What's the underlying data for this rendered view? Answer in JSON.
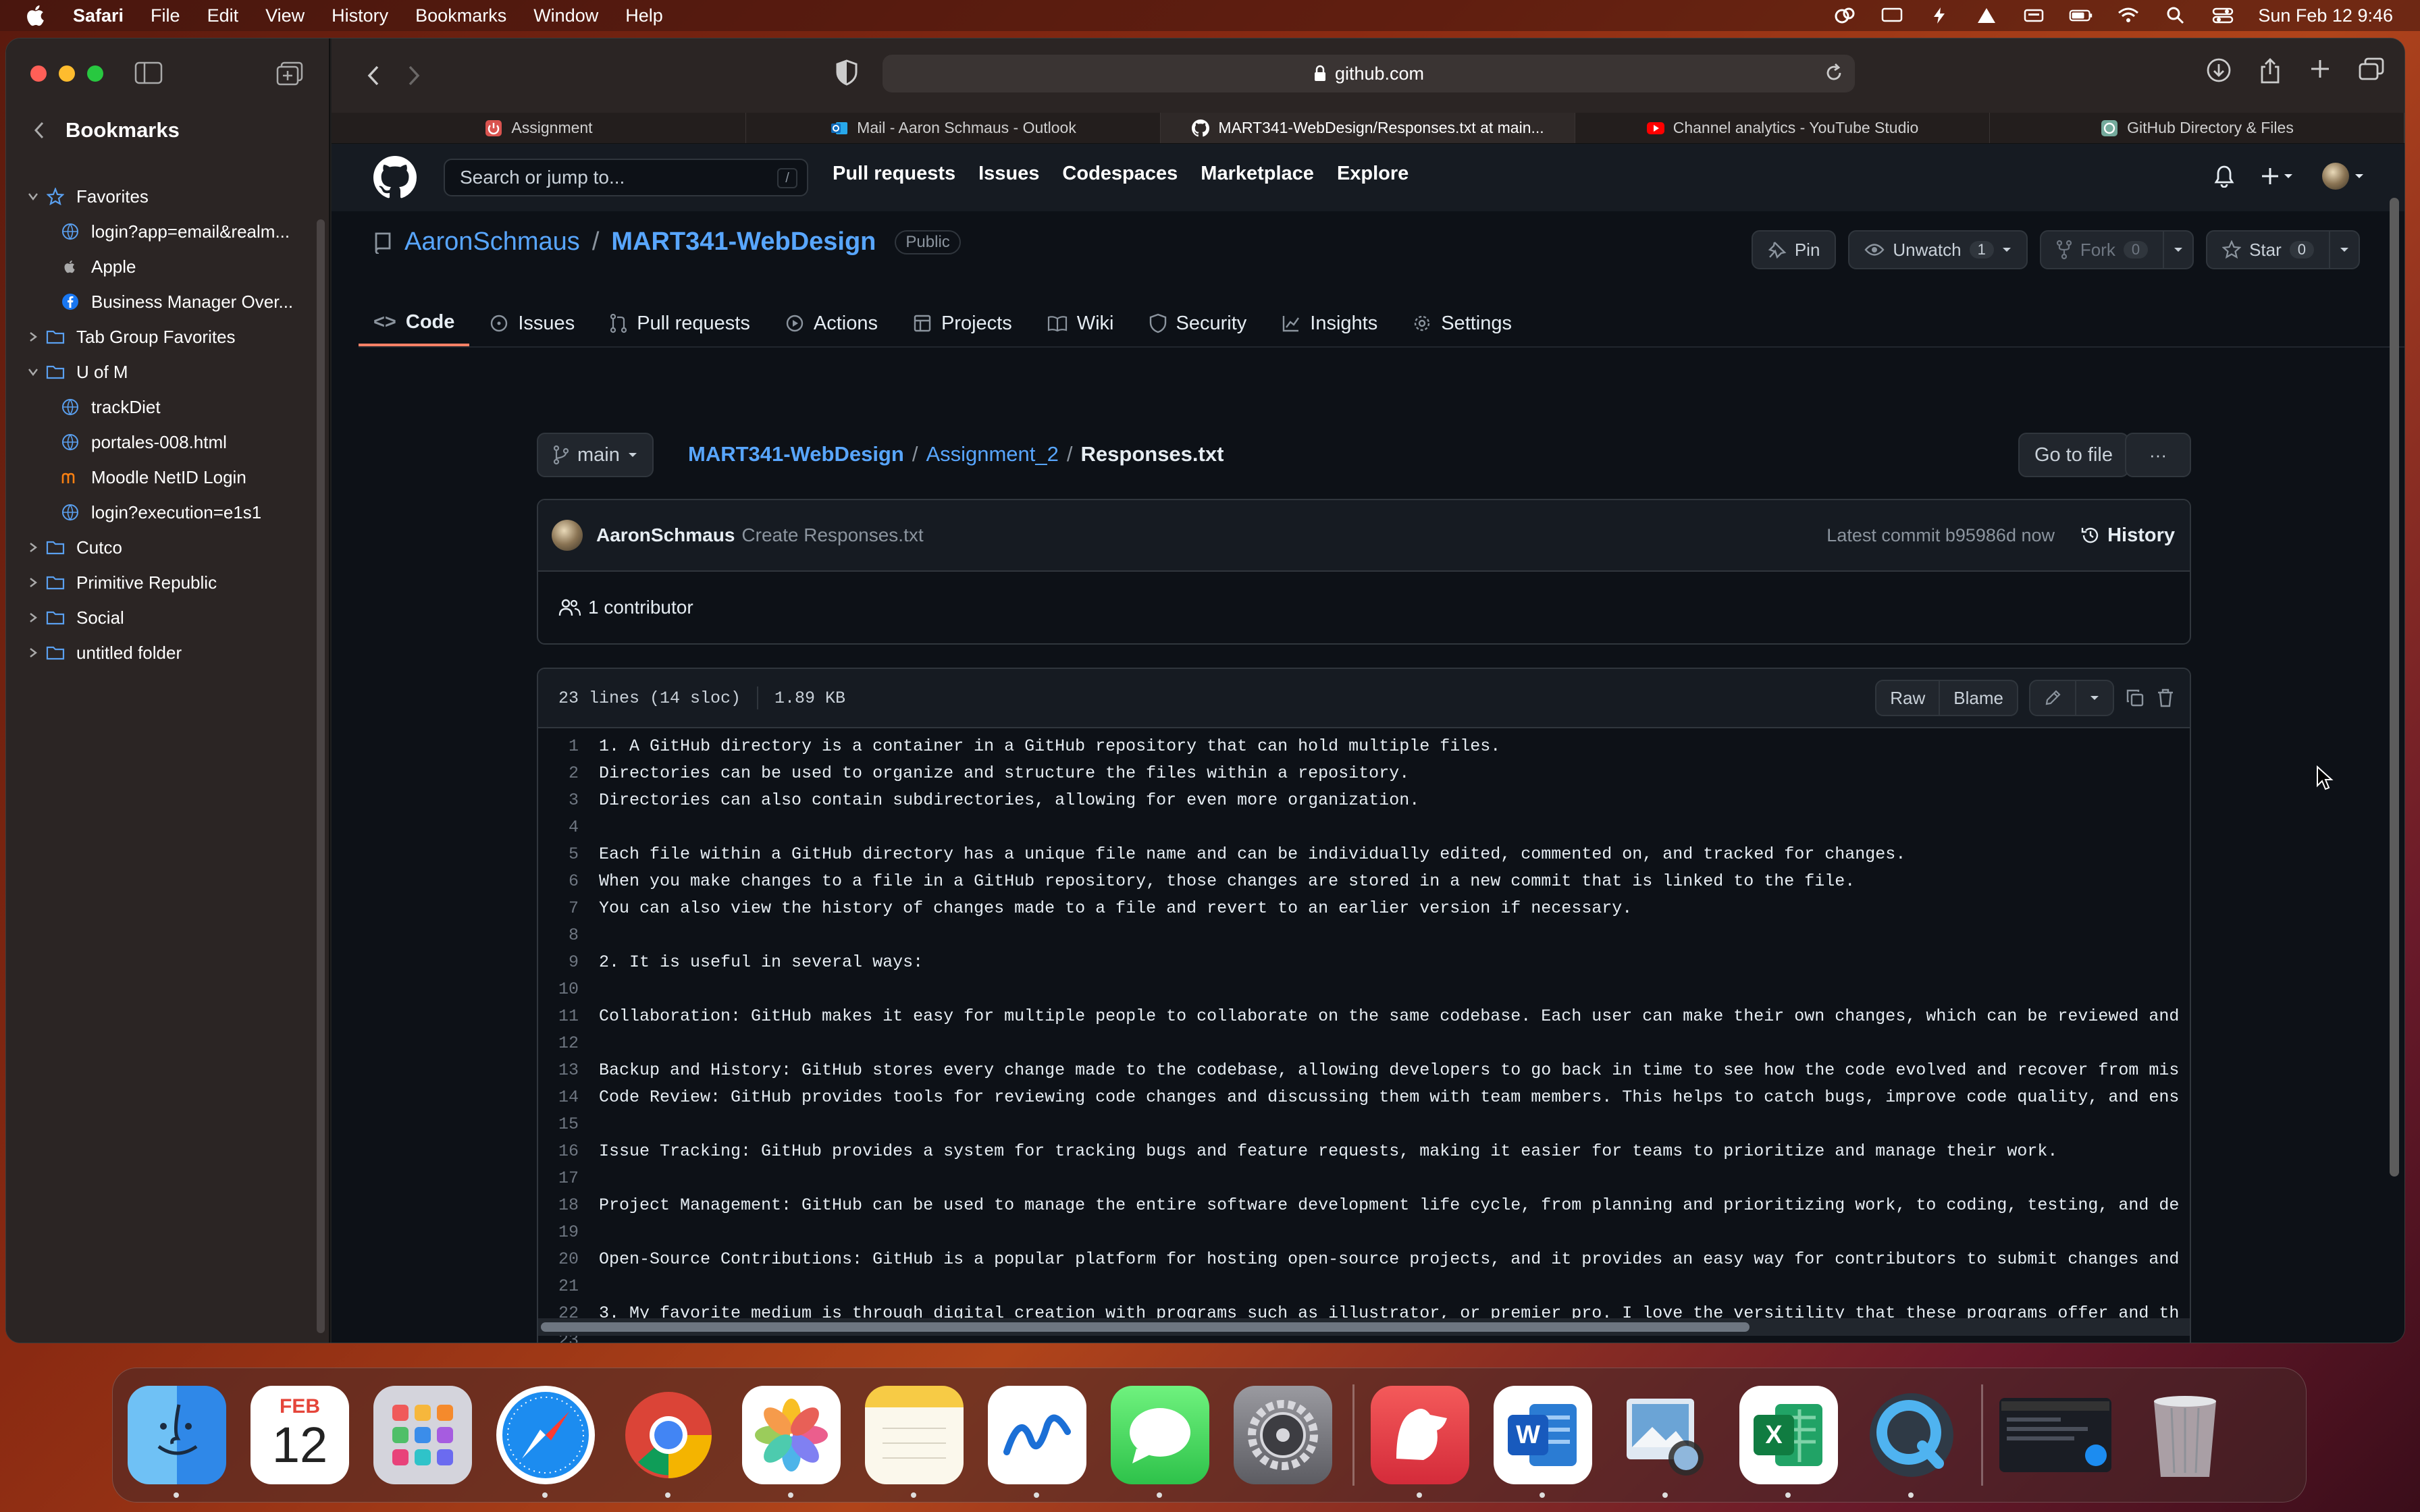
{
  "menubar": {
    "app": "Safari",
    "items": [
      "File",
      "Edit",
      "View",
      "History",
      "Bookmarks",
      "Window",
      "Help"
    ],
    "clock": "Sun Feb 12  9:46"
  },
  "sidebar": {
    "title": "Bookmarks",
    "items": [
      {
        "label": "Favorites",
        "level": 0,
        "expanded": true,
        "icon": "star-icon"
      },
      {
        "label": "login?app=email&realm...",
        "level": 1,
        "icon": "globe-icon"
      },
      {
        "label": "Apple",
        "level": 1,
        "icon": "apple-icon"
      },
      {
        "label": "Business Manager Over...",
        "level": 1,
        "icon": "facebook-icon"
      },
      {
        "label": "Tab Group Favorites",
        "level": 0,
        "expanded": false,
        "icon": "folder-icon"
      },
      {
        "label": "U of M",
        "level": 0,
        "expanded": true,
        "icon": "folder-icon"
      },
      {
        "label": "trackDiet",
        "level": 1,
        "icon": "globe-icon"
      },
      {
        "label": "portales-008.html",
        "level": 1,
        "icon": "globe-icon"
      },
      {
        "label": "Moodle NetID Login",
        "level": 1,
        "icon": "moodle-icon"
      },
      {
        "label": "login?execution=e1s1",
        "level": 1,
        "icon": "globe-icon"
      },
      {
        "label": "Cutco",
        "level": 0,
        "expanded": false,
        "icon": "folder-icon"
      },
      {
        "label": "Primitive Republic",
        "level": 0,
        "expanded": false,
        "icon": "folder-icon"
      },
      {
        "label": "Social",
        "level": 0,
        "expanded": false,
        "icon": "folder-icon"
      },
      {
        "label": "untitled folder",
        "level": 0,
        "expanded": false,
        "icon": "folder-icon"
      }
    ]
  },
  "toolbar": {
    "url": "github.com"
  },
  "tabs": [
    {
      "label": "Assignment",
      "icon": "power-icon",
      "color": "#d9534f"
    },
    {
      "label": "Mail - Aaron Schmaus - Outlook",
      "icon": "outlook-icon",
      "color": "#0f6cbd"
    },
    {
      "label": "MART341-WebDesign/Responses.txt at main...",
      "icon": "github-icon",
      "color": "#ffffff",
      "active": true
    },
    {
      "label": "Channel analytics - YouTube Studio",
      "icon": "youtube-icon",
      "color": "#ff0000"
    },
    {
      "label": "GitHub Directory & Files",
      "icon": "openai-icon",
      "color": "#74aa9c"
    }
  ],
  "github": {
    "search_placeholder": "Search or jump to...",
    "slash": "/",
    "nav": [
      "Pull requests",
      "Issues",
      "Codespaces",
      "Marketplace",
      "Explore"
    ],
    "owner": "AaronSchmaus",
    "repo": "MART341-WebDesign",
    "visibility": "Public",
    "actions": {
      "pin": "Pin",
      "unwatch": "Unwatch",
      "unwatch_count": "1",
      "fork": "Fork",
      "fork_count": "0",
      "star": "Star",
      "star_count": "0"
    },
    "repo_tabs": [
      "Code",
      "Issues",
      "Pull requests",
      "Actions",
      "Projects",
      "Wiki",
      "Security",
      "Insights",
      "Settings"
    ],
    "branch": "main",
    "path": {
      "root": "MART341-WebDesign",
      "dir": "Assignment_2",
      "file": "Responses.txt"
    },
    "go_to_file": "Go to file",
    "more": "···",
    "commit": {
      "author": "AaronSchmaus",
      "message": "Create Responses.txt",
      "latest": "Latest commit b95986d now",
      "history": "History"
    },
    "contributors": "1 contributor",
    "file_info": {
      "lines": "23 lines (14 sloc)",
      "size": "1.89 KB"
    },
    "file_buttons": {
      "raw": "Raw",
      "blame": "Blame"
    },
    "code_lines": [
      "1. A GitHub directory is a container in a GitHub repository that can hold multiple files.",
      "Directories can be used to organize and structure the files within a repository.",
      "Directories can also contain subdirectories, allowing for even more organization.",
      "",
      "Each file within a GitHub directory has a unique file name and can be individually edited, commented on, and tracked for changes.",
      "When you make changes to a file in a GitHub repository, those changes are stored in a new commit that is linked to the file.",
      "You can also view the history of changes made to a file and revert to an earlier version if necessary.",
      "",
      "2. It is useful in several ways:",
      "",
      "Collaboration: GitHub makes it easy for multiple people to collaborate on the same codebase. Each user can make their own changes, which can be reviewed and",
      "",
      "Backup and History: GitHub stores every change made to the codebase, allowing developers to go back in time to see how the code evolved and recover from mis",
      "Code Review: GitHub provides tools for reviewing code changes and discussing them with team members. This helps to catch bugs, improve code quality, and ens",
      "",
      "Issue Tracking: GitHub provides a system for tracking bugs and feature requests, making it easier for teams to prioritize and manage their work.",
      "",
      "Project Management: GitHub can be used to manage the entire software development life cycle, from planning and prioritizing work, to coding, testing, and de",
      "",
      "Open-Source Contributions: GitHub is a popular platform for hosting open-source projects, and it provides an easy way for contributors to submit changes and",
      "",
      "3. My favorite medium is through digital creation with programs such as illustrator, or premier pro. I love the versitility that these programs offer and th",
      ""
    ]
  },
  "dock": {
    "calendar_month": "FEB",
    "calendar_day": "12",
    "apps": [
      "Finder",
      "Calendar",
      "Launchpad",
      "Safari",
      "Chrome",
      "Photos",
      "Notes",
      "Freeform",
      "Messages",
      "System Settings",
      "Bear",
      "Word",
      "Preview",
      "Excel",
      "QuickTime Player",
      "Screen",
      "Trash"
    ]
  }
}
